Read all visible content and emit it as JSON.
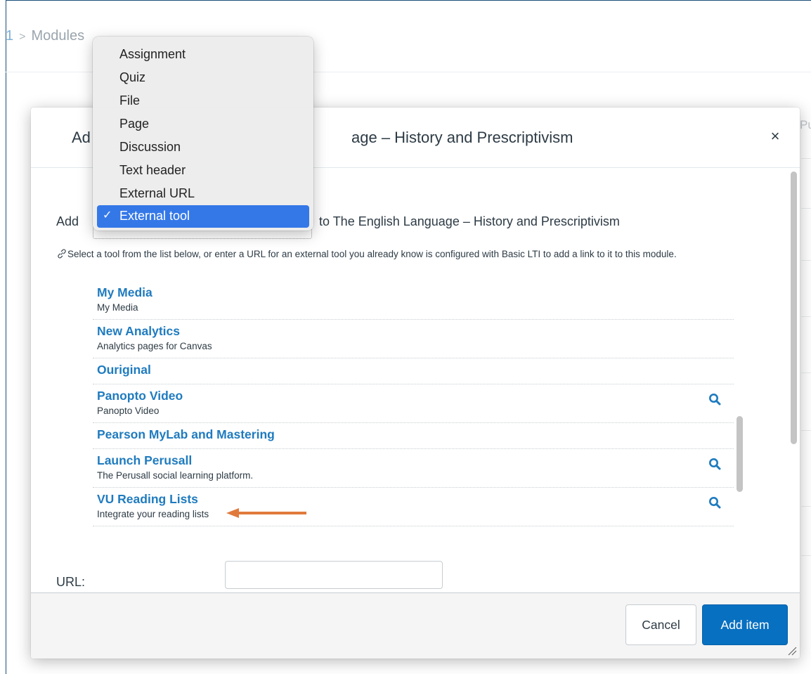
{
  "breadcrumb": {
    "prefix": "1",
    "separator": ">",
    "current": "Modules"
  },
  "background": {
    "side_text": "Pu"
  },
  "modal": {
    "title_prefix": "Ad",
    "title_suffix": "age – History and Prescriptivism",
    "close_glyph": "×",
    "add_label": "Add",
    "to_text": "to The English Language – History and Prescriptivism",
    "instructions": "Select a tool from the list below, or enter a URL for an external tool you already know is configured with Basic LTI to add a link to it to this module.",
    "tools": [
      {
        "name": "My Media",
        "description": "My Media",
        "has_search": false
      },
      {
        "name": "New Analytics",
        "description": "Analytics pages for Canvas",
        "has_search": false
      },
      {
        "name": "Ouriginal",
        "description": "",
        "has_search": false
      },
      {
        "name": "Panopto Video",
        "description": "Panopto Video",
        "has_search": true
      },
      {
        "name": "Pearson MyLab and Mastering",
        "description": "",
        "has_search": false
      },
      {
        "name": "Launch Perusall",
        "description": "The Perusall social learning platform.",
        "has_search": true
      },
      {
        "name": "VU Reading Lists",
        "description": "Integrate your reading lists",
        "has_search": true
      }
    ],
    "url_label": "URL:",
    "url_value": "",
    "cancel_label": "Cancel",
    "add_item_label": "Add item"
  },
  "dropdown": {
    "options": [
      "Assignment",
      "Quiz",
      "File",
      "Page",
      "Discussion",
      "Text header",
      "External URL",
      "External tool"
    ],
    "selected": "External tool",
    "check_glyph": "✓"
  },
  "colors": {
    "link_blue": "#1f7bbf",
    "primary_button": "#0770c1",
    "menu_highlight": "#3478e8",
    "arrow": "#e07a3c"
  }
}
